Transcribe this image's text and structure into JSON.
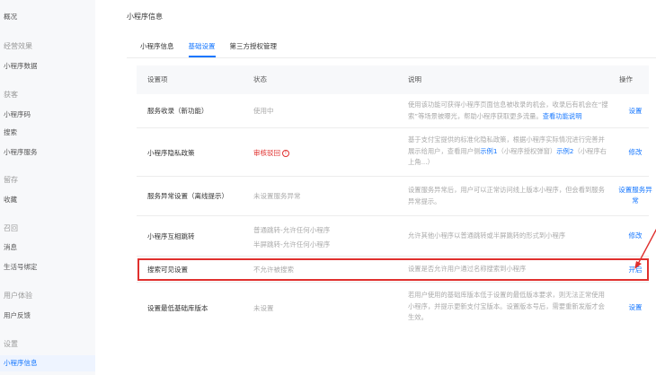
{
  "sidebar": {
    "items": [
      {
        "type": "item",
        "label": "概况"
      },
      {
        "type": "group",
        "label": "经营效果"
      },
      {
        "type": "item",
        "label": "小程序数据"
      },
      {
        "type": "group",
        "label": "获客"
      },
      {
        "type": "item",
        "label": "小程序码"
      },
      {
        "type": "item",
        "label": "搜索"
      },
      {
        "type": "item",
        "label": "小程序服务"
      },
      {
        "type": "group",
        "label": "留存"
      },
      {
        "type": "item",
        "label": "收藏"
      },
      {
        "type": "group",
        "label": "召回"
      },
      {
        "type": "item",
        "label": "消息"
      },
      {
        "type": "item",
        "label": "生活号绑定"
      },
      {
        "type": "group",
        "label": "用户体验"
      },
      {
        "type": "item",
        "label": "用户反馈"
      },
      {
        "type": "group",
        "label": "设置"
      },
      {
        "type": "item",
        "label": "小程序信息",
        "active": true
      }
    ]
  },
  "page": {
    "title": "小程序信息"
  },
  "tabs": [
    {
      "label": "小程序信息",
      "active": false
    },
    {
      "label": "基础设置",
      "active": true
    },
    {
      "label": "第三方授权管理",
      "active": false
    }
  ],
  "table": {
    "headers": {
      "item": "设置项",
      "status": "状态",
      "desc": "说明",
      "action": "操作"
    },
    "rows": [
      {
        "name": "服务收录（新功能）",
        "status": "使用中",
        "desc": "使用该功能可获得小程序页面信息被收录的机会，收录后有机会在“搜索”等场景被曝光，帮助小程序获取更多流量。",
        "desc_link": "查看功能说明",
        "action": "设置"
      },
      {
        "name": "小程序隐私政策",
        "status": "审核驳回",
        "status_icon": "!",
        "desc_pre": "基于支付宝提供的标准化隐私政策，根据小程序实际情况进行完善并展示给用户，查看用户侧",
        "desc_link1": "示例1",
        "desc_mid": "（小程序授权弹窗）",
        "desc_link2": "示例2",
        "desc_post": "（小程序右上角...）",
        "action": "修改"
      },
      {
        "name": "服务异常设置（离线提示）",
        "status": "未设置服务异常",
        "desc": "设置服务异常后，用户可以正常访问线上版本小程序，但会看到服务异常提示。",
        "action": "设置服务异常"
      },
      {
        "name": "小程序互相跳转",
        "status_line1": "普通跳转-允许任何小程序",
        "status_line2": "半屏跳转-允许任何小程序",
        "desc": "允许其他小程序以普通跳转或半屏跳转的形式到小程序",
        "action": "修改"
      },
      {
        "name": "搜索可见设置",
        "status": "不允许被搜索",
        "desc": "设置是否允许用户通过名称搜索到小程序",
        "action": "开启"
      },
      {
        "name": "设置最低基础库版本",
        "status": "未设置",
        "desc": "若用户使用的基础库版本低于设置的最低版本要求，则无法正常使用小程序，并提示更新支付宝版本。设置版本号后，需要重新发版才会生效。",
        "action": "设置"
      }
    ]
  },
  "colors": {
    "accent": "#1677ff",
    "danger": "#e0302e",
    "muted": "#aaaaaa"
  }
}
